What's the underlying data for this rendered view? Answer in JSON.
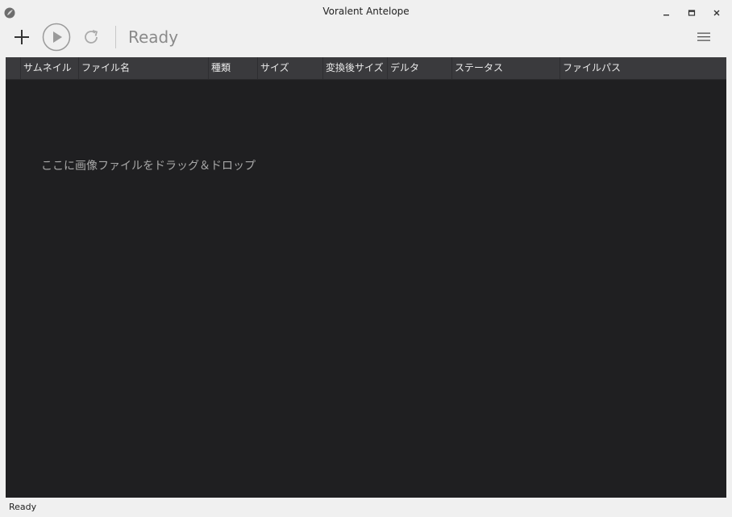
{
  "window": {
    "title": "Voralent Antelope"
  },
  "toolbar": {
    "add_icon": "plus-icon",
    "run_icon": "play-circle-icon",
    "refresh_icon": "refresh-icon",
    "status": "Ready",
    "menu_icon": "hamburger-menu-icon"
  },
  "grid": {
    "columns": [
      "サムネイル",
      "ファイル名",
      "種類",
      "サイズ",
      "変換後サイズ",
      "デルタ",
      "ステータス",
      "ファイルパス"
    ],
    "empty_hint": "ここに画像ファイルをドラッグ＆ドロップ"
  },
  "statusbar": {
    "text": "Ready"
  },
  "colors": {
    "grid_bg": "#1f1f21",
    "header_bg": "#3a3a3d",
    "chrome_bg": "#f0f0f0"
  }
}
